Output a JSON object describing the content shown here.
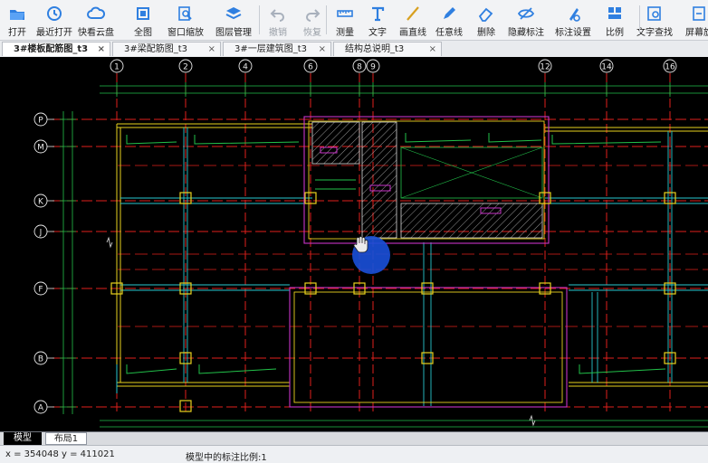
{
  "toolbar": {
    "items": [
      {
        "label": "打开",
        "icon": "folder-open-icon"
      },
      {
        "label": "最近打开",
        "icon": "recent-clock-icon"
      },
      {
        "label": "快看云盘",
        "icon": "cloud-drive-icon"
      },
      {
        "label": "全图",
        "icon": "full-view-icon"
      },
      {
        "label": "窗口缩放",
        "icon": "window-zoom-icon"
      },
      {
        "label": "图层管理",
        "icon": "layers-icon"
      },
      {
        "label": "撤销",
        "icon": "undo-icon",
        "disabled": true
      },
      {
        "label": "恢复",
        "icon": "redo-icon",
        "disabled": true
      },
      {
        "label": "测量",
        "icon": "measure-icon"
      },
      {
        "label": "文字",
        "icon": "text-tool-icon"
      },
      {
        "label": "画直线",
        "icon": "line-tool-icon"
      },
      {
        "label": "任意线",
        "icon": "freehand-pen-icon"
      },
      {
        "label": "删除",
        "icon": "eraser-icon"
      },
      {
        "label": "隐藏标注",
        "icon": "hide-eye-icon"
      },
      {
        "label": "标注设置",
        "icon": "annotation-settings-icon"
      },
      {
        "label": "比例",
        "icon": "scale-ratio-icon"
      },
      {
        "label": "文字查找",
        "icon": "text-search-icon"
      },
      {
        "label": "屏幕旋",
        "icon": "screen-rotate-icon"
      }
    ]
  },
  "tabs": [
    {
      "label": "3#楼板配筋图_t3",
      "active": true
    },
    {
      "label": "3#梁配筋图_t3",
      "active": false
    },
    {
      "label": "3#一层建筑图_t3",
      "active": false
    },
    {
      "label": "结构总说明_t3",
      "active": false
    }
  ],
  "tab_close_glyph": "×",
  "drawing": {
    "column_axes": [
      "1",
      "2",
      "4",
      "6",
      "8",
      "9",
      "12",
      "14",
      "16"
    ],
    "row_axes": [
      "P",
      "M",
      "K",
      "J",
      "F",
      "B",
      "A"
    ],
    "colors": {
      "grid_red": "#e0201b",
      "wall_yellow": "#e9d21e",
      "wall_cyan": "#27c7cf",
      "outline_magenta": "#c832c8",
      "annotation_green": "#22c24a",
      "hatch": "#b8b8b8"
    }
  },
  "layout_tabs": [
    {
      "label": "模型",
      "active": true
    },
    {
      "label": "布局1",
      "active": false
    }
  ],
  "status": {
    "coordinates": "x = 354048  y = 411021",
    "annotation_scale": "模型中的标注比例:1"
  }
}
